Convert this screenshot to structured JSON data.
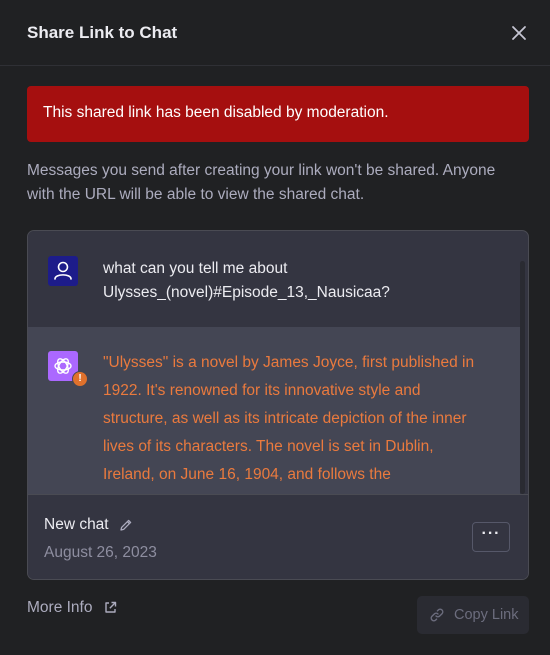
{
  "dialog": {
    "title": "Share Link to Chat",
    "close_icon": "close-icon"
  },
  "banner": {
    "text": "This shared link has been disabled by moderation.",
    "color": "#a50f0f"
  },
  "description": "Messages you send after creating your link won't be shared. Anyone with the URL will be able to view the shared chat.",
  "preview": {
    "user_message": {
      "avatar_icon": "user-icon",
      "line1": "what can you tell me about",
      "line2": "Ulysses_(novel)#Episode_13,_Nausicaa?"
    },
    "assistant_message": {
      "avatar_icon": "openai-logo-icon",
      "warning_badge": "!",
      "text": "\"Ulysses\" is a novel by James Joyce, first published in 1922. It's renowned for its innovative style and structure, as well as its intricate depiction of the inner lives of its characters. The novel is set in Dublin, Ireland, on June 16, 1904, and follows the",
      "color": "#ea7a3e"
    },
    "footer": {
      "chat_name": "New chat",
      "edit_icon": "pencil-icon",
      "date": "August 26, 2023",
      "more_label": "···"
    }
  },
  "actions": {
    "more_info_label": "More Info",
    "external_icon": "external-link-icon",
    "copy_link_label": "Copy Link",
    "copy_icon": "link-icon"
  }
}
